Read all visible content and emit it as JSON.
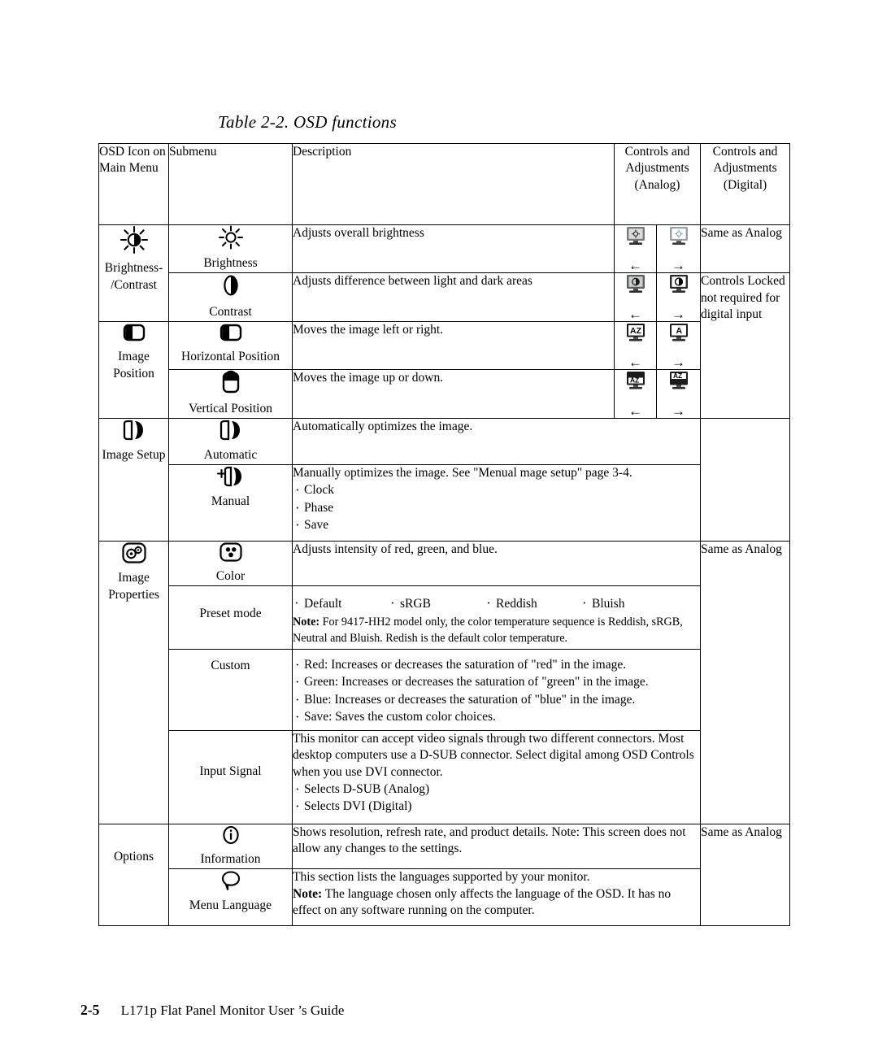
{
  "caption": "Table 2-2. OSD functions",
  "headers": {
    "icon": "OSD Icon on Main Menu",
    "submenu": "Submenu",
    "description": "Description",
    "analog": "Controls and Adjustments (Analog)",
    "digital": "Controls and Adjustments (Digital)"
  },
  "groups": {
    "brightness_contrast": {
      "label": "Brightness- /Contrast",
      "icon": "brightness-contrast-icon",
      "rows": {
        "brightness": {
          "submenu": "Brightness",
          "icon": "sun-icon",
          "description": "Adjusts overall brightness",
          "analog_left": "←",
          "analog_right": "→",
          "digital": "Same as Analog"
        },
        "contrast": {
          "submenu": "Contrast",
          "icon": "contrast-icon",
          "description": "Adjusts difference between light and dark areas",
          "analog_left": "←",
          "analog_right": "→",
          "digital": "Controls Locked not required for digital input"
        }
      }
    },
    "image_position": {
      "label": "Image Position",
      "icon": "image-position-icon",
      "rows": {
        "horizontal": {
          "submenu": "Horizontal Position",
          "icon": "horizontal-position-icon",
          "description": "Moves the image left or right.",
          "analog_left": "←",
          "analog_right": "→"
        },
        "vertical": {
          "submenu": "Vertical Position",
          "icon": "vertical-position-icon",
          "description": "Moves the image up or down.",
          "analog_left": "←",
          "analog_right": "→"
        }
      }
    },
    "image_setup": {
      "label": "Image Setup",
      "icon": "image-setup-icon",
      "rows": {
        "automatic": {
          "submenu": "Automatic",
          "icon": "automatic-icon",
          "description": "Automatically optimizes the image."
        },
        "manual": {
          "submenu": "Manual",
          "icon": "manual-icon",
          "description": "Manually optimizes the image. See  \"Menual mage setup\" page 3-4.",
          "bullets": [
            "Clock",
            "Phase",
            "Save"
          ]
        }
      }
    },
    "image_properties": {
      "label": "Image Properties",
      "icon": "image-properties-icon",
      "digital": "Same as Analog",
      "rows": {
        "color": {
          "submenu": "Color",
          "icon": "color-icon",
          "description": "Adjusts intensity of red, green, and blue."
        },
        "preset": {
          "submenu": "Preset mode",
          "options": [
            "Default",
            "sRGB",
            "Reddish",
            "Bluish"
          ],
          "note_label": "Note:",
          "note_text": " For 9417-HH2 model only, the color temperature sequence is Reddish, sRGB, Neutral and Bluish. Redish is the default color temperature."
        },
        "custom": {
          "submenu": "Custom",
          "bullets": [
            "Red: Increases or decreases the saturation of \"red\" in the image.",
            "Green: Increases or decreases the saturation of \"green\" in the image.",
            "Blue: Increases or decreases the saturation of \"blue\"  in the image.",
            "Save: Saves the custom color choices."
          ]
        },
        "input_signal": {
          "submenu": "Input  Signal",
          "description": "This monitor can accept video signals through two different connectors. Most desktop computers use a D-SUB connector. Select digital among OSD Controls when you use DVI connector.",
          "bullets": [
            "Selects D-SUB (Analog)",
            "Selects DVI (Digital)"
          ]
        }
      }
    },
    "options": {
      "label": "Options",
      "digital": "Same as Analog",
      "rows": {
        "information": {
          "submenu": "Information",
          "icon": "information-icon",
          "description": "Shows resolution, refresh rate, and product details. Note: This screen does not allow any changes to the settings."
        },
        "menu_language": {
          "submenu": "Menu Language",
          "icon": "menu-language-icon",
          "description": "This section lists the languages supported by your monitor.",
          "note_label": "Note:",
          "note_text": " The language chosen only affects the language of the OSD. It has no effect on any software running on the computer."
        }
      }
    }
  },
  "footer": {
    "page": "2-5",
    "title": "L171p Flat Panel Monitor User ’s Guide"
  }
}
